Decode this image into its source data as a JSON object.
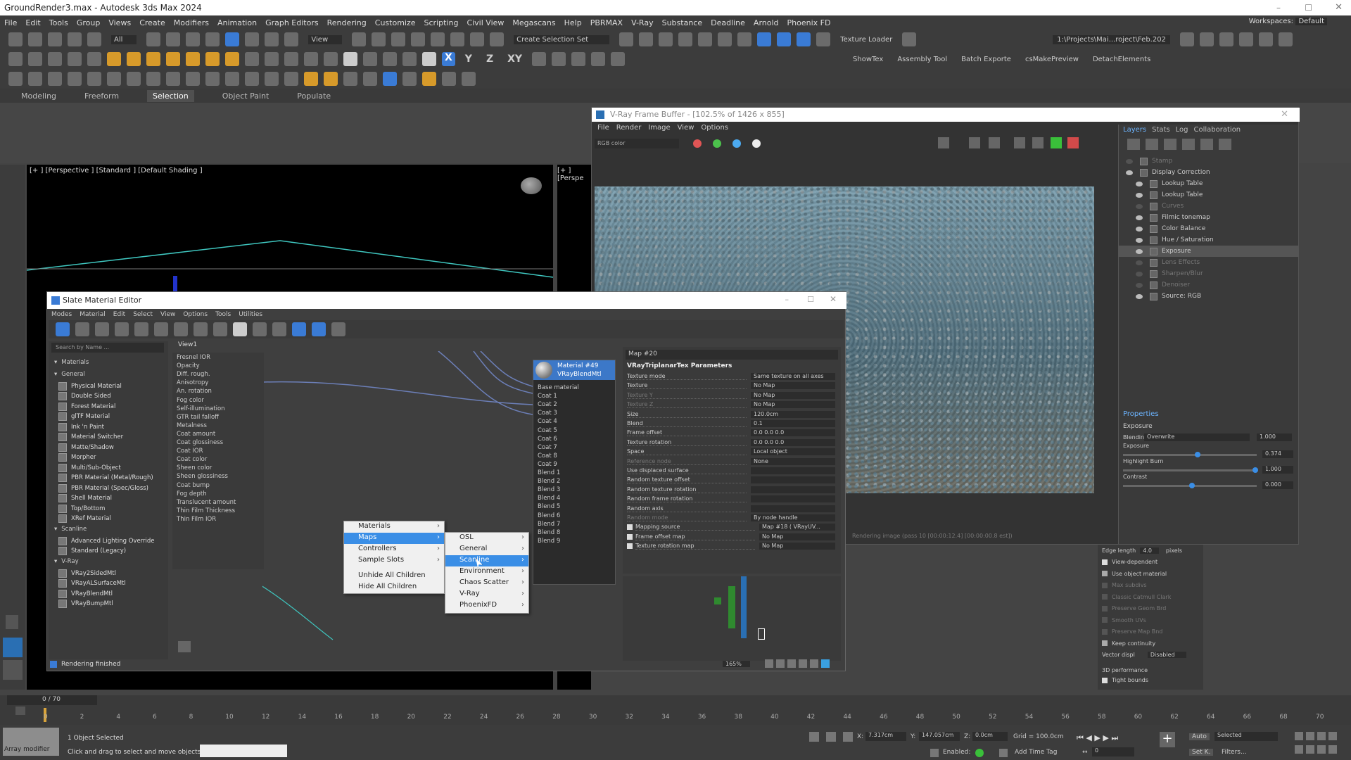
{
  "app": {
    "title": "GroundRender3.max - Autodesk 3ds Max 2024",
    "workspace_label": "Workspaces:",
    "workspace_value": "Default"
  },
  "menubar": [
    "File",
    "Edit",
    "Tools",
    "Group",
    "Views",
    "Create",
    "Modifiers",
    "Animation",
    "Graph Editors",
    "Rendering",
    "Customize",
    "Scripting",
    "Civil View",
    "Megascans",
    "Help",
    "PBRMAX",
    "V-Ray",
    "Substance",
    "Deadline",
    "Arnold",
    "Phoenix FD"
  ],
  "toolbar": {
    "all_filter": "All",
    "view_dropdown": "View",
    "selection_set": "Create Selection Set",
    "axis_x": "X",
    "axis_y": "Y",
    "axis_z": "Z",
    "axis_xy": "XY",
    "texture_loader": "Texture Loader",
    "project_path": "1:\\Projects\\Mai...roject\\Feb.202",
    "showtex": "ShowTex",
    "assembly_tool": "Assembly Tool",
    "batch_exporte": "Batch Exporte",
    "csmakepreview": "csMakePreview",
    "detachelements": "DetachElements"
  },
  "ribbon_tabs": [
    "Modeling",
    "Freeform",
    "Selection",
    "Object Paint",
    "Populate"
  ],
  "viewport": {
    "label": "[+ ] [Perspective ] [Standard ] [Default Shading ]",
    "label2": "[+ ] [Perspe"
  },
  "vfb": {
    "title": "V-Ray Frame Buffer - [102.5% of 1426 x 855]",
    "menu": [
      "File",
      "Render",
      "Image",
      "View",
      "Options"
    ],
    "channel": "RGB color",
    "status": "Rendering image (pass 10 [00:00:12.4] [00:00:00.8 est])",
    "tabs": [
      "Layers",
      "Stats",
      "Log",
      "Collaboration"
    ],
    "layers": [
      {
        "name": "Stamp",
        "dim": true,
        "sel": false
      },
      {
        "name": "Display Correction",
        "dim": false,
        "sel": false
      },
      {
        "name": "Lookup Table",
        "dim": false,
        "sel": false
      },
      {
        "name": "Lookup Table",
        "dim": false,
        "sel": false
      },
      {
        "name": "Curves",
        "dim": true,
        "sel": false
      },
      {
        "name": "Filmic tonemap",
        "dim": false,
        "sel": false
      },
      {
        "name": "Color Balance",
        "dim": false,
        "sel": false
      },
      {
        "name": "Hue / Saturation",
        "dim": false,
        "sel": false
      },
      {
        "name": "Exposure",
        "dim": false,
        "sel": true
      },
      {
        "name": "Lens Effects",
        "dim": true,
        "sel": false
      },
      {
        "name": "Sharpen/Blur",
        "dim": true,
        "sel": false
      },
      {
        "name": "Denoiser",
        "dim": true,
        "sel": false
      },
      {
        "name": "Source: RGB",
        "dim": false,
        "sel": false
      }
    ],
    "properties_label": "Properties",
    "exposure_label": "Exposure",
    "blending_label": "Blending",
    "blending_mode": "Overwrite",
    "blending_value": "1.000",
    "exposure_value": "0.374",
    "highlight_burn_label": "Highlight Burn",
    "highlight_burn_value": "1.000",
    "contrast_label": "Contrast",
    "contrast_value": "0.000"
  },
  "sme": {
    "title": "Slate Material Editor",
    "menu": [
      "Modes",
      "Material",
      "Edit",
      "Select",
      "View",
      "Options",
      "Tools",
      "Utilities"
    ],
    "search_placeholder": "Search by Name ...",
    "view_tab": "View1",
    "browser": [
      {
        "label": "Materials",
        "kind": "h"
      },
      {
        "label": "General",
        "kind": "h"
      },
      {
        "label": "Physical Material",
        "kind": "m"
      },
      {
        "label": "Double Sided",
        "kind": "m"
      },
      {
        "label": "Forest Material",
        "kind": "m"
      },
      {
        "label": "glTF Material",
        "kind": "m"
      },
      {
        "label": "Ink 'n Paint",
        "kind": "m"
      },
      {
        "label": "Material Switcher",
        "kind": "m"
      },
      {
        "label": "Matte/Shadow",
        "kind": "m"
      },
      {
        "label": "Morpher",
        "kind": "m"
      },
      {
        "label": "Multi/Sub-Object",
        "kind": "m"
      },
      {
        "label": "PBR Material (Metal/Rough)",
        "kind": "m"
      },
      {
        "label": "PBR Material (Spec/Gloss)",
        "kind": "m"
      },
      {
        "label": "Shell Material",
        "kind": "m"
      },
      {
        "label": "Top/Bottom",
        "kind": "m"
      },
      {
        "label": "XRef Material",
        "kind": "m"
      },
      {
        "label": "Scanline",
        "kind": "h"
      },
      {
        "label": "Advanced Lighting Override",
        "kind": "m"
      },
      {
        "label": "Standard (Legacy)",
        "kind": "m"
      },
      {
        "label": "V-Ray",
        "kind": "h"
      },
      {
        "label": "VRay2SidedMtl",
        "kind": "m"
      },
      {
        "label": "VRayALSurfaceMtl",
        "kind": "m"
      },
      {
        "label": "VRayBlendMtl",
        "kind": "m"
      },
      {
        "label": "VRayBumpMtl",
        "kind": "m"
      }
    ],
    "slots": [
      "Fresnel IOR",
      "Opacity",
      "Diff. rough.",
      "Anisotropy",
      "An. rotation",
      "Fog color",
      "Self-illumination",
      "GTR tail falloff",
      "Metalness",
      "Coat amount",
      "Coat glossiness",
      "Coat IOR",
      "Coat color",
      "Sheen color",
      "Sheen glossiness",
      "Coat bump",
      "Fog depth",
      "Translucent amount",
      "Thin Film Thickness",
      "Thin Film IOR"
    ],
    "node": {
      "name": "Material #49",
      "type": "VRayBlendMtl",
      "ports": [
        "Base material",
        "Coat 1",
        "Coat 2",
        "Coat 3",
        "Coat 4",
        "Coat 5",
        "Coat 6",
        "Coat 7",
        "Coat 8",
        "Coat 9",
        "Blend 1",
        "Blend 2",
        "Blend 3",
        "Blend 4",
        "Blend 5",
        "Blend 6",
        "Blend 7",
        "Blend 8",
        "Blend 9"
      ]
    },
    "params": {
      "map_name": "Map #20",
      "rollout": "VRayTriplanarTex Parameters",
      "rows": [
        {
          "label": "Texture mode",
          "value": "Same texture on all axes",
          "dim": false
        },
        {
          "label": "Texture",
          "value": "No Map",
          "dim": false
        },
        {
          "label": "Texture Y",
          "value": "No Map",
          "dim": true
        },
        {
          "label": "Texture Z",
          "value": "No Map",
          "dim": true
        },
        {
          "label": "Size",
          "value": "120.0cm",
          "dim": false
        },
        {
          "label": "Blend",
          "value": "0.1",
          "dim": false
        },
        {
          "label": "Frame offset",
          "value": "0.0   0.0   0.0",
          "dim": false
        },
        {
          "label": "Texture rotation",
          "value": "0.0   0.0   0.0",
          "dim": false
        },
        {
          "label": "Space",
          "value": "Local object",
          "dim": false
        },
        {
          "label": "Reference node",
          "value": "None",
          "dim": true
        },
        {
          "label": "Use displaced surface",
          "value": "",
          "dim": false
        },
        {
          "label": "Random texture offset",
          "value": "",
          "dim": false
        },
        {
          "label": "Random texture rotation",
          "value": "",
          "dim": false
        },
        {
          "label": "Random frame rotation",
          "value": "",
          "dim": false
        },
        {
          "label": "Random axis",
          "value": "",
          "dim": false
        },
        {
          "label": "Random mode",
          "value": "By node handle",
          "dim": true
        },
        {
          "label": "Mapping source",
          "value": "Map #18 ( VRayUV...",
          "dim": false
        },
        {
          "label": "Frame offset map",
          "value": "No Map",
          "dim": false
        },
        {
          "label": "Texture rotation map",
          "value": "No Map",
          "dim": false
        }
      ]
    },
    "zoom": "165%",
    "status": "Rendering finished"
  },
  "context_menu": {
    "main": [
      "Materials",
      "Maps",
      "Controllers",
      "Sample Slots",
      "Unhide All Children",
      "Hide All Children"
    ],
    "sub": [
      "OSL",
      "General",
      "Scanline",
      "Environment",
      "Chaos Scatter",
      "V-Ray",
      "PhoenixFD"
    ]
  },
  "cmd_panel": {
    "edge_length_label": "Edge length",
    "edge_length_value": "4.0",
    "edge_unit": "pixels",
    "rows": [
      {
        "label": "View-dependent",
        "checked": true,
        "dim": false
      },
      {
        "label": "Use object material",
        "checked": false,
        "dim": false
      },
      {
        "label": "Max subdivs",
        "checked": false,
        "dim": true
      },
      {
        "label": "Classic Catmull Clark",
        "checked": false,
        "dim": true
      },
      {
        "label": "Preserve Geom Brd",
        "checked": false,
        "dim": true
      },
      {
        "label": "Smooth UVs",
        "checked": false,
        "dim": true
      },
      {
        "label": "Preserve Map Bnd",
        "checked": false,
        "dim": true
      },
      {
        "label": "Keep continuity",
        "checked": false,
        "dim": false
      }
    ],
    "vector_displ_label": "Vector displ",
    "vector_displ_value": "Disabled",
    "perf_label": "3D performance",
    "tight_bounds": "Tight bounds"
  },
  "timeline": {
    "frame_counter": "0 / 70",
    "ticks": [
      "0",
      "2",
      "4",
      "6",
      "8",
      "10",
      "12",
      "14",
      "16",
      "18",
      "20",
      "22",
      "24",
      "26",
      "28",
      "30",
      "32",
      "34",
      "36",
      "38",
      "40",
      "42",
      "44",
      "46",
      "48",
      "50",
      "52",
      "54",
      "56",
      "58",
      "60",
      "62",
      "64",
      "66",
      "68",
      "70"
    ]
  },
  "status": {
    "selected": "1 Object Selected",
    "hint": "Click and drag to select and move objects",
    "x": "7.317cm",
    "y": "147.057cm",
    "z": "0.0cm",
    "grid": "Grid = 100.0cm",
    "enabled": "Enabled:",
    "add_time_tag": "Add Time Tag",
    "auto": "Auto",
    "selected_dropdown": "Selected",
    "setk": "Set K.",
    "filters": "Filters...",
    "modifier": "Array modifier",
    "frame_field": "0"
  }
}
